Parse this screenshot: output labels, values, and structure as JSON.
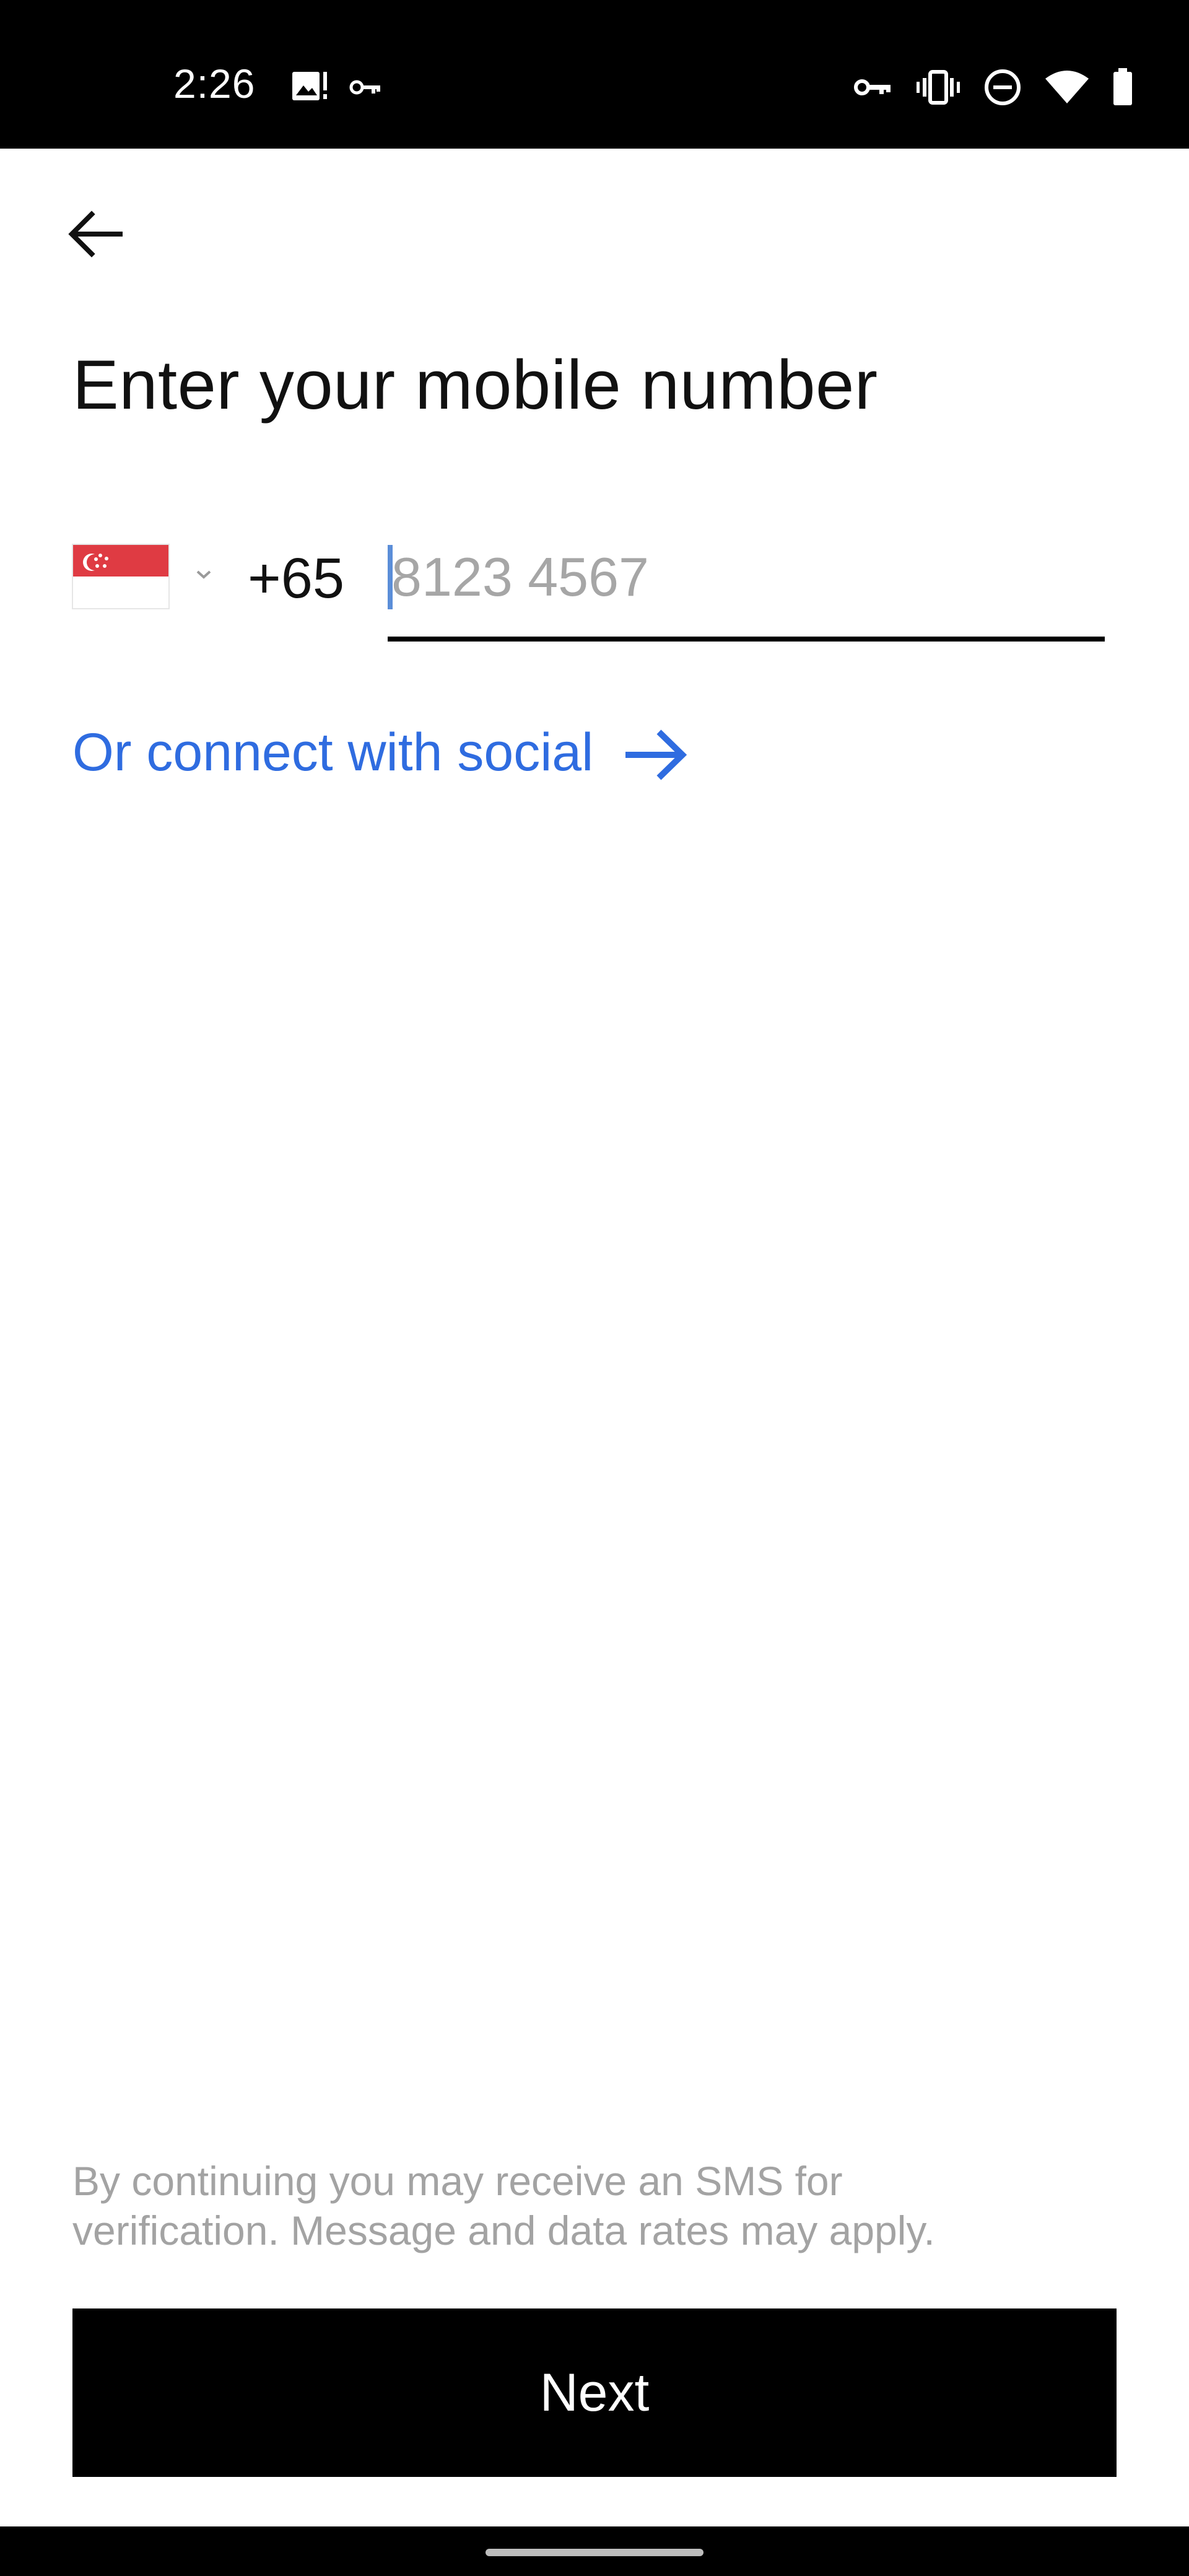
{
  "status_bar": {
    "time": "2:26",
    "left_icons": [
      "image-alert-icon",
      "key-icon"
    ],
    "right_icons": [
      "vpn-key-icon",
      "vibrate-icon",
      "do-not-disturb-icon",
      "wifi-icon",
      "battery-icon"
    ]
  },
  "header": {
    "back_icon": "arrow-left-icon",
    "title": "Enter your mobile number"
  },
  "phone": {
    "country_flag": "singapore-flag-icon",
    "dial_code": "+65",
    "placeholder": "8123 4567",
    "value": ""
  },
  "social": {
    "label": "Or connect with social",
    "icon": "arrow-right-icon"
  },
  "footer": {
    "disclaimer_line1": "By continuing you may receive an SMS for",
    "disclaimer_line2": "verification. Message and data rates may apply.",
    "next_label": "Next"
  },
  "colors": {
    "link_blue": "#2f6ce0",
    "flag_red": "#df3b43",
    "caret_blue": "#5b8ed8",
    "disclaimer_gray": "#a3a3a3"
  }
}
